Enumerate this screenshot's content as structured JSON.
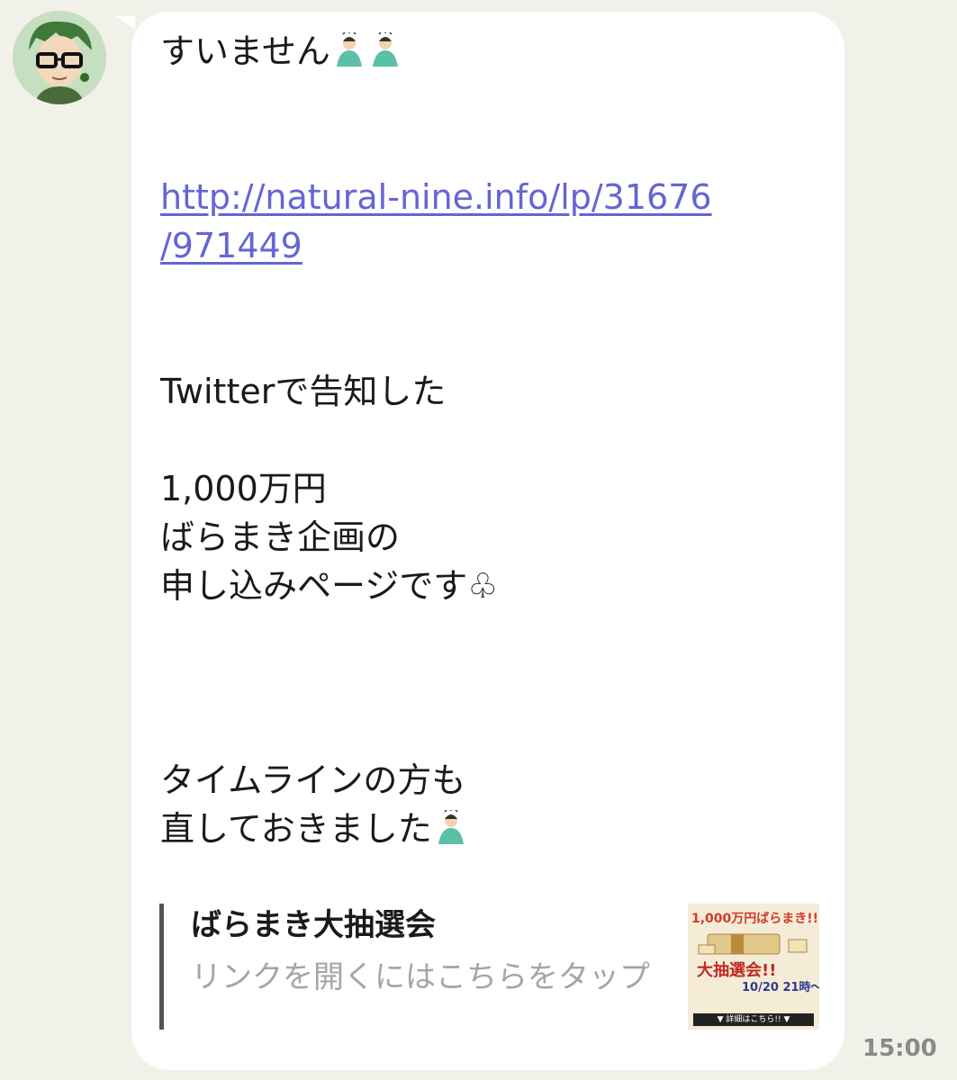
{
  "message": {
    "line1": "すいません",
    "link_line1": "http://natural-nine.info/lp/31676",
    "link_line2": "/971449",
    "line_twitter": "Twitterで告知した",
    "line_amount": "1,000万円",
    "line_plan": "ばらまき企画の",
    "line_apply": "申し込みページです",
    "club_symbol": "♧",
    "line_timeline": "タイムラインの方も",
    "line_fixed": "直しておきました"
  },
  "link_preview": {
    "title": "ばらまき大抽選会",
    "subtitle": "リンクを開くにはこちらをタップ",
    "thumb_head": "1,000万円ばらまき!!",
    "thumb_big": "大抽選会!!",
    "thumb_date": "10/20 21時〜",
    "thumb_foot": "▼ 詳細はこちら!! ▼"
  },
  "timestamp": "15:00",
  "icons": {
    "avatar": "user-avatar-icon",
    "emoji": "person-bowing-icon"
  },
  "colors": {
    "background": "#f1f1ea",
    "bubble": "#ffffff",
    "link": "#6565d4",
    "preview_subtitle": "#a5a5a5"
  }
}
